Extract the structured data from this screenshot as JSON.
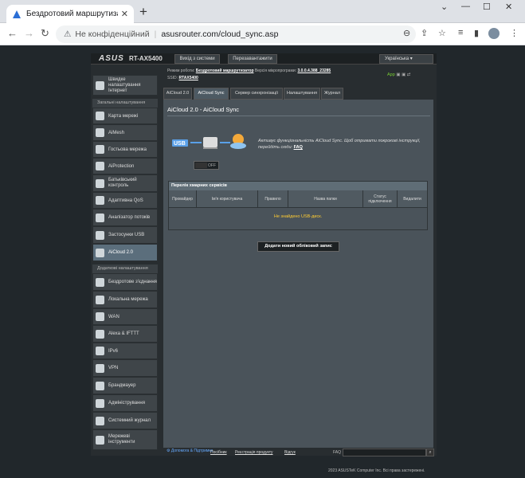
{
  "browser": {
    "tab_title": "Бездротовий маршрутизатор AS",
    "url_security": "Не конфіденційний",
    "url": "asusrouter.com/cloud_sync.asp"
  },
  "router": {
    "brand": "ASUS",
    "model": "RT-AX5400",
    "logout": "Вихід з системи",
    "reboot": "Перезавантажити",
    "language": "Українська",
    "status_mode_label": "Режим роботи:",
    "status_mode": "Бездротовий маршрутизатор",
    "status_fw_label": "Версія мікропрограми:",
    "status_fw": "3.0.0.4.388_23285",
    "status_ssid_label": "SSID:",
    "status_ssid": "RTAX5400",
    "status_app": "App"
  },
  "sidebar": {
    "top_item": "Швидке налаштування Інтернет",
    "general_header": "Загальні налаштування",
    "general": [
      "Карта мережі",
      "AiMesh",
      "Гостьова мережа",
      "AiProtection",
      "Батьківський контроль",
      "Адаптивна QoS",
      "Аналізатор потоків",
      "Застосунки USB",
      "AiCloud 2.0"
    ],
    "advanced_header": "Додаткові налаштування",
    "advanced": [
      "Бездротове з'єднання",
      "Локальна мережа",
      "WAN",
      "Alexa & IFTTT",
      "IPv6",
      "VPN",
      "Брандмауер",
      "Адміністрування",
      "Системний журнал",
      "Мережеві інструменти"
    ]
  },
  "tabs": [
    "AiCloud 2.0",
    "AiCloud Sync",
    "Сервер синхронізації",
    "Налаштування",
    "Журнал"
  ],
  "content": {
    "title": "AiCloud 2.0 - AiCloud Sync",
    "desc": "Активує функціональність AiCloud Sync. Щоб отримати покрокові інструкції, перейдіть сюди:",
    "faq": "FAQ",
    "toggle": "OFF",
    "table_title": "Перелік хмарних сервісів",
    "columns": [
      "Провайдер",
      "Ім'я користувача",
      "Правило",
      "Назва папки",
      "Статус підключення",
      "Видалити"
    ],
    "empty": "Не знайдено USB-диск.",
    "add_button": "Додати новий обліковий запис"
  },
  "footer": {
    "help": "Допомога & Підтримка",
    "manual": "Посібник",
    "register": "Реєстрація продукту",
    "feedback": "Відгук",
    "faq": "FAQ",
    "copyright": "2023 ASUSTeK Computer Inc. Всі права застережені."
  }
}
